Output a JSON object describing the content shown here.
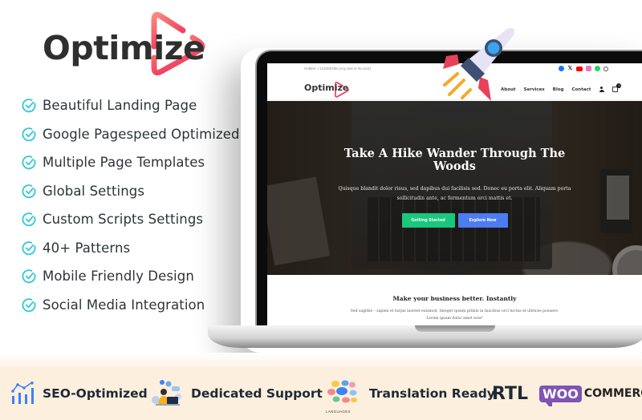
{
  "brand": {
    "name": "Optimize",
    "accent_color": "#f0315a",
    "accent_light": "#f98a7e"
  },
  "features": [
    {
      "label": "Beautiful Landing Page",
      "icon": "check-circle-icon"
    },
    {
      "label": "Google Pagespeed Optimized",
      "icon": "check-circle-icon"
    },
    {
      "label": "Multiple Page Templates",
      "icon": "check-circle-icon"
    },
    {
      "label": "Global Settings",
      "icon": "check-circle-icon"
    },
    {
      "label": "Custom Scripts Settings",
      "icon": "check-circle-icon"
    },
    {
      "label": "40+ Patterns",
      "icon": "check-circle-icon"
    },
    {
      "label": "Mobile Friendly Design",
      "icon": "check-circle-icon"
    },
    {
      "label": "Social Media Integration",
      "icon": "check-circle-icon"
    }
  ],
  "check_color": "#3cc9d8",
  "site": {
    "hotline": "Hotline: +123456789 (Any text or No text)",
    "socials": [
      "facebook-icon",
      "x-icon",
      "youtube-icon",
      "instagram-icon",
      "whatsapp-icon",
      "search-icon"
    ],
    "x_glyph": "𝕏",
    "logo": "Optimize",
    "nav": [
      "About",
      "Services",
      "Blog",
      "Contact"
    ],
    "cart_count": "0",
    "hero": {
      "title": "Take A Hike Wander Through The Woods",
      "subtitle": "Quisque blandit dolor risus, sed dapibus dui facilisis sed. Donec eu porta elit. Aliquam porta sollicitudin ante, ac fermentum orci mattis et.",
      "primary_button": "Getting Started",
      "secondary_button": "Explore Now",
      "primary_color": "#18c87d",
      "secondary_color": "#4d7cf2"
    },
    "section": {
      "title": "Make your business better. Instantly",
      "text": "Sed sagittis – sapien et turpis laoreet euismod. Integer ipsum primis in faucibus orci luctus et ultrices posuere. Lorem ipsum dolor amet now!"
    }
  },
  "badges": {
    "seo": "SEO-Optimized",
    "support": "Dedicated Support",
    "languages_caption": "LANGUAGES",
    "translation": "Translation Ready",
    "rtl": "RTL",
    "woo": "WOO",
    "commerce": "COMMERCE"
  }
}
